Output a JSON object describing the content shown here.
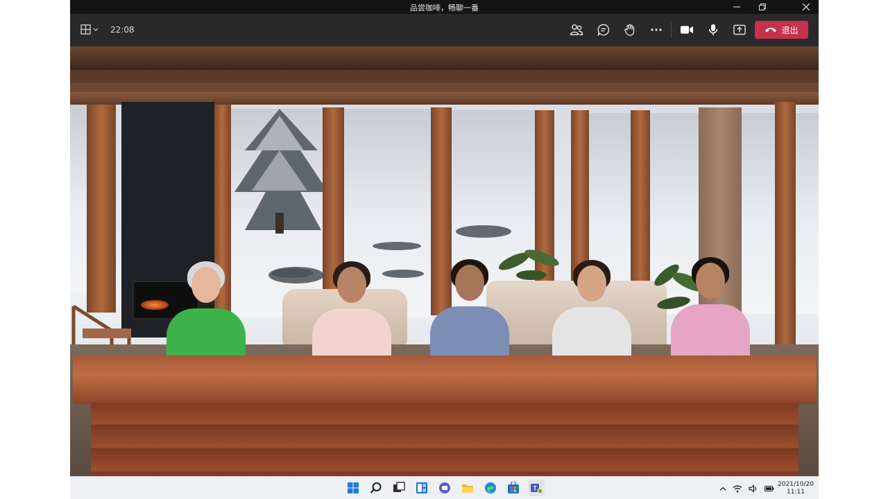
{
  "window": {
    "title": "品尝咖啡，畅聊一番"
  },
  "toolbar": {
    "timer": "22:08",
    "leave_label": "退出",
    "leave_color": "#c4314b"
  },
  "icons": {
    "layout": "grid-layout-icon",
    "people": "people-icon",
    "chat": "chat-icon",
    "hand": "raise-hand-icon",
    "more": "more-icon",
    "camera": "camera-icon",
    "mic": "microphone-icon",
    "share": "share-screen-icon",
    "leave": "phone-hangup-icon"
  },
  "scene": {
    "mode": "together-mode",
    "participants": [
      {
        "hair": "#d8d8d8",
        "skin": "#e6b79c",
        "shirt": "#3db24a"
      },
      {
        "hair": "#2b1d16",
        "skin": "#b88468",
        "shirt": "#f1d4cf"
      },
      {
        "hair": "#1e1511",
        "skin": "#a7755a",
        "shirt": "#7d8eb5"
      },
      {
        "hair": "#2a1c15",
        "skin": "#d5a487",
        "shirt": "#e5e4e4"
      },
      {
        "hair": "#1a1210",
        "skin": "#b68463",
        "shirt": "#e6a4c6"
      }
    ]
  },
  "taskbar": {
    "apps": [
      "windows-start-icon",
      "search-icon",
      "task-view-icon",
      "widgets-icon",
      "chat-app-icon",
      "file-explorer-icon",
      "edge-icon",
      "store-icon",
      "teams-icon"
    ],
    "date": "2021/10/20",
    "time": "11:11"
  }
}
